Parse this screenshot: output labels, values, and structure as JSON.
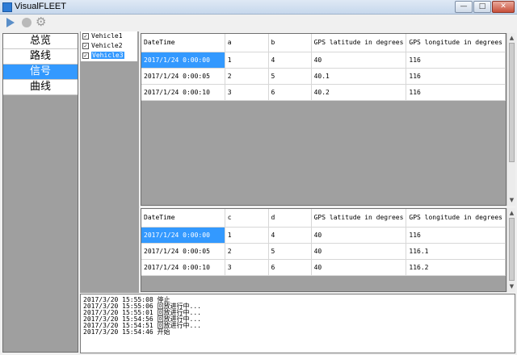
{
  "window": {
    "title": "VisualFLEET",
    "min_glyph": "—",
    "max_glyph": "□",
    "close_glyph": "✕"
  },
  "toolbar": {
    "play_icon": "play-icon",
    "stop_icon": "stop-icon",
    "settings_icon": "gear-icon",
    "gear_glyph": "⚙"
  },
  "nav": {
    "items": [
      {
        "label": "总览",
        "selected": false
      },
      {
        "label": "路线",
        "selected": false
      },
      {
        "label": "信号",
        "selected": true
      },
      {
        "label": "曲线",
        "selected": false
      }
    ]
  },
  "vehicles": [
    {
      "label": "Vehicle1",
      "checked": true
    },
    {
      "label": "Vehicle2",
      "checked": true
    },
    {
      "label": "Vehicle3",
      "checked": true,
      "selected": true
    }
  ],
  "check_glyph": "✓",
  "grid_top": {
    "headers": [
      "DateTime",
      "a",
      "b",
      "GPS latitude in degrees",
      "GPS longitude in degrees"
    ],
    "rows": [
      [
        "2017/1/24 0:00:00",
        "1",
        "4",
        "40",
        "116"
      ],
      [
        "2017/1/24 0:00:05",
        "2",
        "5",
        "40.1",
        "116"
      ],
      [
        "2017/1/24 0:00:10",
        "3",
        "6",
        "40.2",
        "116"
      ]
    ]
  },
  "grid_bottom": {
    "headers": [
      "DateTime",
      "c",
      "d",
      "GPS latitude in degrees",
      "GPS longitude in degrees"
    ],
    "rows": [
      [
        "2017/1/24 0:00:00",
        "1",
        "4",
        "40",
        "116"
      ],
      [
        "2017/1/24 0:00:05",
        "2",
        "5",
        "40",
        "116.1"
      ],
      [
        "2017/1/24 0:00:10",
        "3",
        "6",
        "40",
        "116.2"
      ]
    ]
  },
  "scroll": {
    "up": "▲",
    "down": "▼"
  },
  "log": [
    "2017/3/20 15:55:08 停止",
    "2017/3/20 15:55:06 回放进行中...",
    "2017/3/20 15:55:01 回放进行中...",
    "2017/3/20 15:54:56 回放进行中...",
    "2017/3/20 15:54:51 回放进行中...",
    "2017/3/20 15:54:46 开始"
  ],
  "colors": {
    "selection": "#3399ff",
    "panel_gray": "#a0a0a0"
  }
}
